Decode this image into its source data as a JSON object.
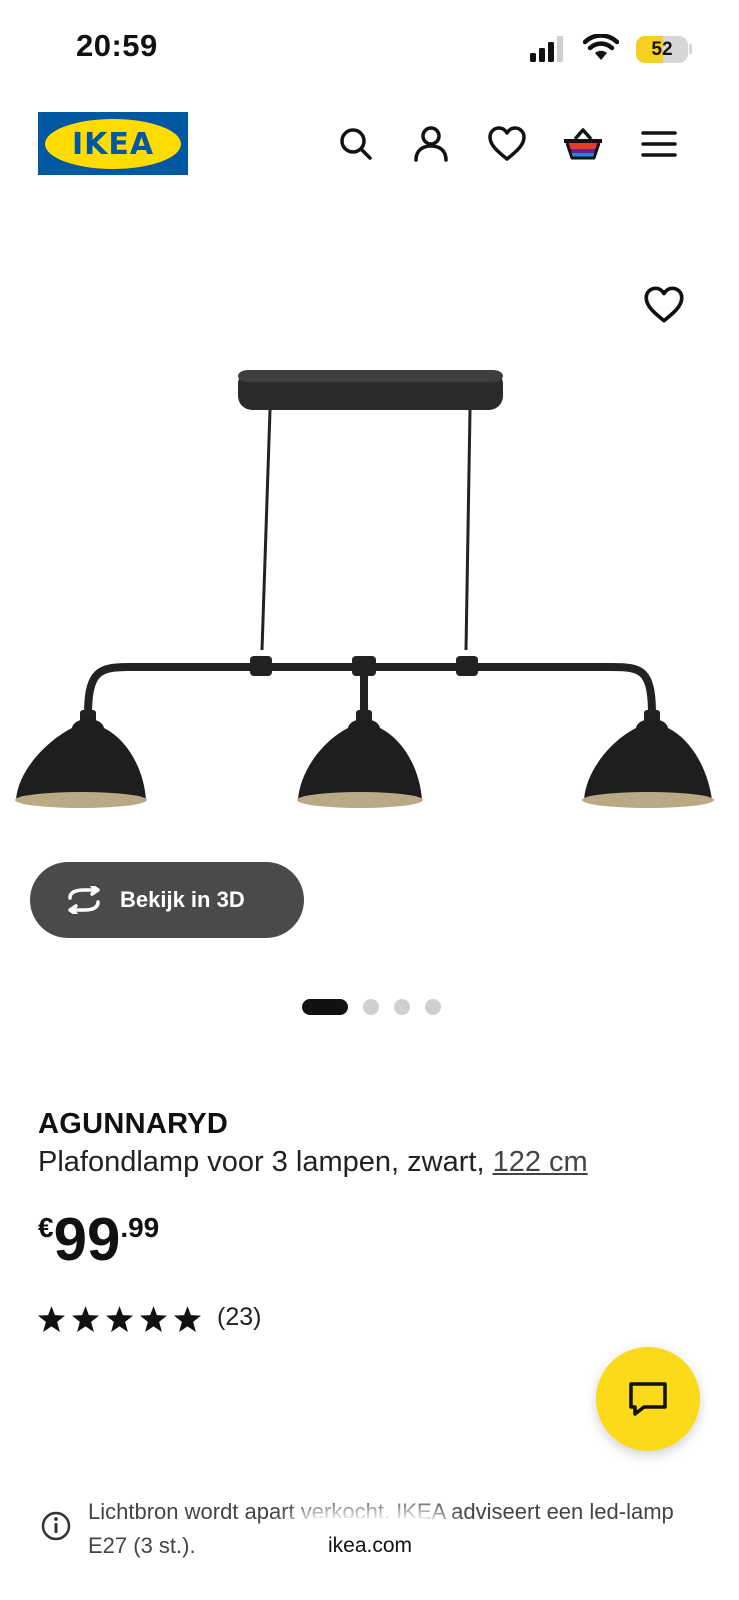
{
  "status_bar": {
    "time": "20:59",
    "battery_level": "52",
    "battery_fraction": 0.52,
    "icons": [
      "cellular-signal-icon",
      "wifi-icon",
      "battery-icon"
    ]
  },
  "header": {
    "logo_text": "IKEA",
    "icons": [
      "search-icon",
      "account-icon",
      "heart-icon",
      "basket-icon",
      "menu-icon"
    ]
  },
  "gallery": {
    "view_3d_label": "Bekijk in 3D",
    "slides_total": 4,
    "active_slide": 1
  },
  "product": {
    "name": "AGUNNARYD",
    "description": "Plafondlamp voor 3 lampen, zwart,",
    "size_link": "122 cm",
    "currency": "€",
    "price_integer": "99",
    "price_decimal": ".99",
    "rating_stars": 5,
    "review_count": "(23)"
  },
  "notice": {
    "text": "Lichtbron wordt apart verkocht. IKEA adviseert een led-lamp E27 (3 st.)."
  },
  "browser": {
    "url": "ikea.com"
  },
  "colors": {
    "ikea_blue": "#0058a3",
    "ikea_yellow": "#ffdb00",
    "chat_yellow": "#fada1a",
    "view3d_bg": "#4a4a4a"
  }
}
